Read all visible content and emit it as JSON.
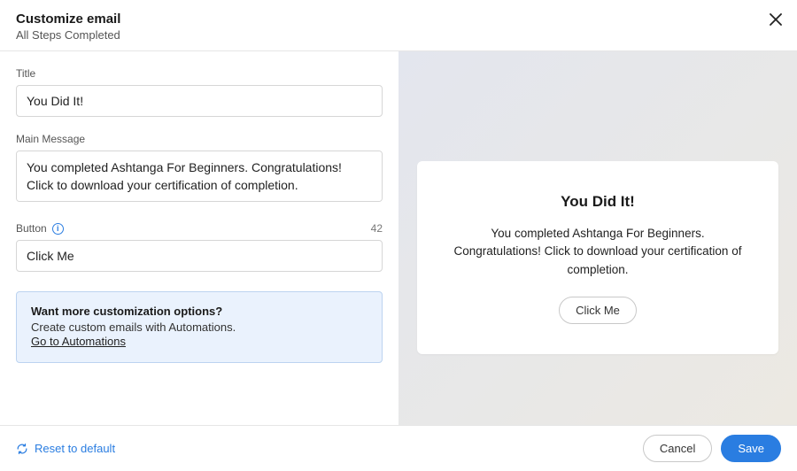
{
  "header": {
    "title": "Customize email",
    "subtitle": "All Steps Completed"
  },
  "form": {
    "title_label": "Title",
    "title_value": "You Did It!",
    "message_label": "Main Message",
    "message_value": "You completed Ashtanga For Beginners. Congratulations! Click to download your certification of completion.",
    "button_label": "Button",
    "button_value": "Click Me",
    "button_counter": "42"
  },
  "notice": {
    "title": "Want more customization options?",
    "text": "Create custom emails with Automations.",
    "link": "Go to Automations"
  },
  "preview": {
    "title": "You Did It!",
    "message": "You completed Ashtanga For Beginners. Congratulations! Click to download your certification of completion.",
    "button": "Click Me"
  },
  "footer": {
    "reset": "Reset to default",
    "cancel": "Cancel",
    "save": "Save"
  }
}
